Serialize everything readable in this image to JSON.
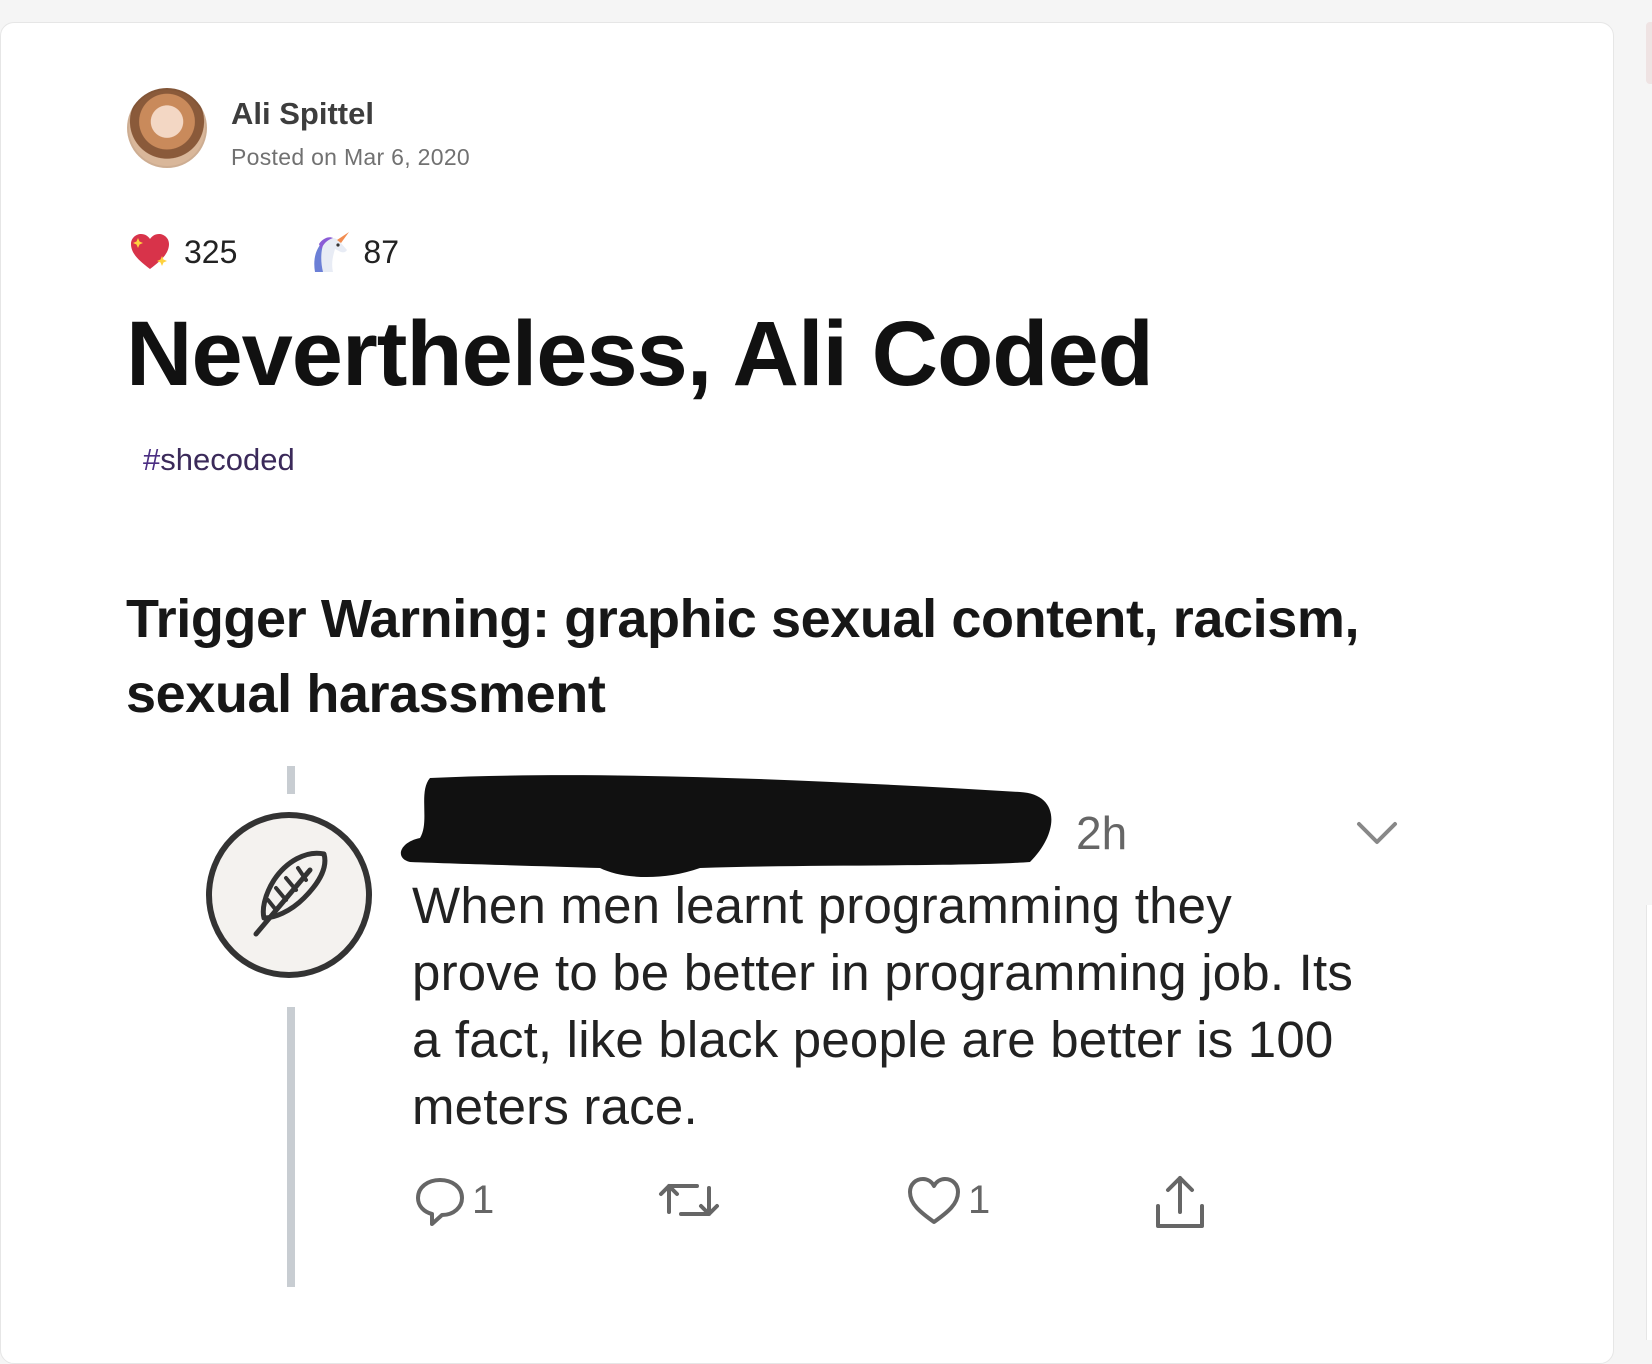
{
  "author": {
    "name": "Ali Spittel",
    "posted": "Posted on Mar 6, 2020"
  },
  "reactions": [
    {
      "icon": "sparkle-heart-icon",
      "count": "325"
    },
    {
      "icon": "unicorn-icon",
      "count": "87"
    }
  ],
  "post": {
    "title": "Nevertheless, Ali Coded",
    "tag_hash": "#",
    "tag": "shecoded",
    "trigger_warning": "Trigger Warning: graphic sexual content, racism, sexual harassment"
  },
  "tweet": {
    "time": "2h",
    "text": "When men learnt programming they prove to be better in programming job. Its a fact, like black people are better is 100 meters race.",
    "actions": [
      {
        "icon": "reply-icon",
        "count": "1"
      },
      {
        "icon": "retweet-icon",
        "count": ""
      },
      {
        "icon": "like-icon",
        "count": "1"
      },
      {
        "icon": "share-icon",
        "count": ""
      }
    ]
  }
}
